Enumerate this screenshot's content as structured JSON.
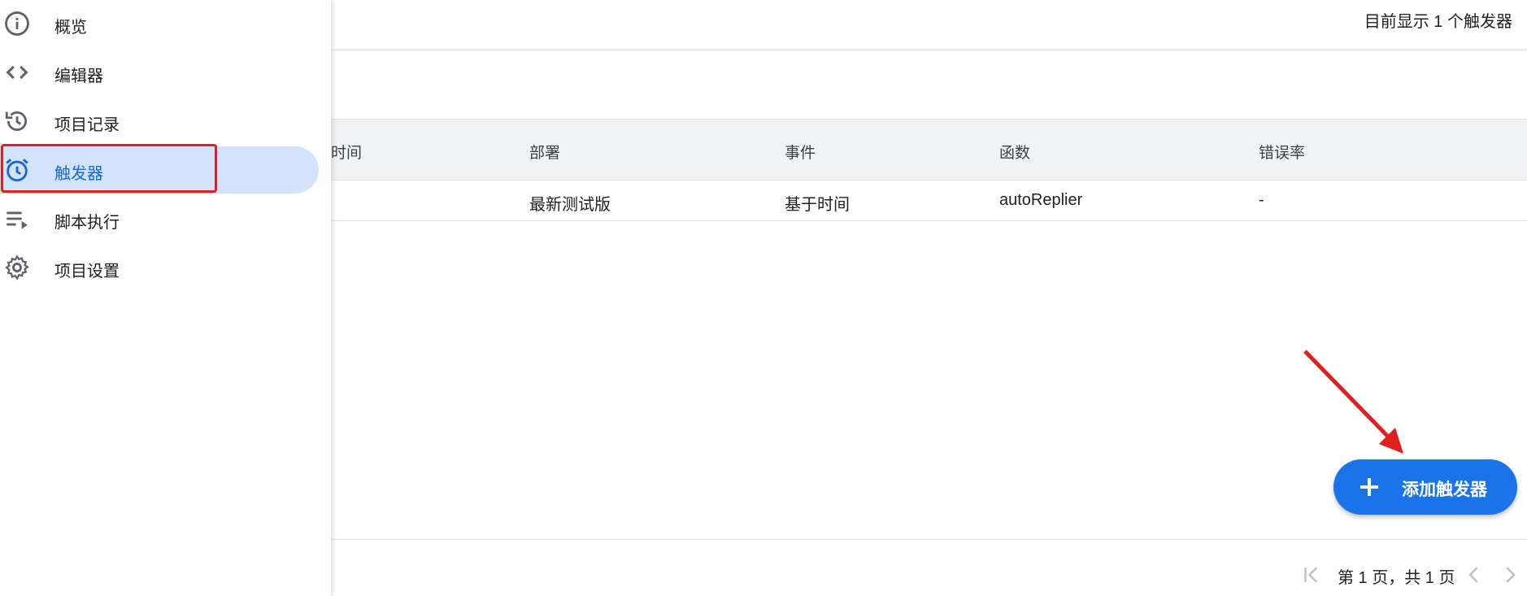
{
  "header": {
    "trigger_count": "目前显示 1 个触发器"
  },
  "sidebar": {
    "items": [
      {
        "label": "概览",
        "icon": "info-icon"
      },
      {
        "label": "编辑器",
        "icon": "code-icon"
      },
      {
        "label": "项目记录",
        "icon": "history-icon"
      },
      {
        "label": "触发器",
        "icon": "alarm-clock-icon",
        "active": true
      },
      {
        "label": "脚本执行",
        "icon": "playlist-play-icon"
      },
      {
        "label": "项目设置",
        "icon": "gear-icon"
      }
    ]
  },
  "table": {
    "columns": [
      "时间",
      "部署",
      "事件",
      "函数",
      "错误率"
    ],
    "rows": [
      {
        "time": "",
        "deployment": "最新测试版",
        "event": "基于时间",
        "function": "autoReplier",
        "error_rate": "-"
      }
    ]
  },
  "pagination": {
    "text": "第 1 页，共 1 页"
  },
  "fab": {
    "label": "添加触发器",
    "icon": "plus-icon"
  },
  "colors": {
    "accent": "#1a73e8",
    "active_bg": "#d2e3fc",
    "annotation": "#e02020"
  }
}
